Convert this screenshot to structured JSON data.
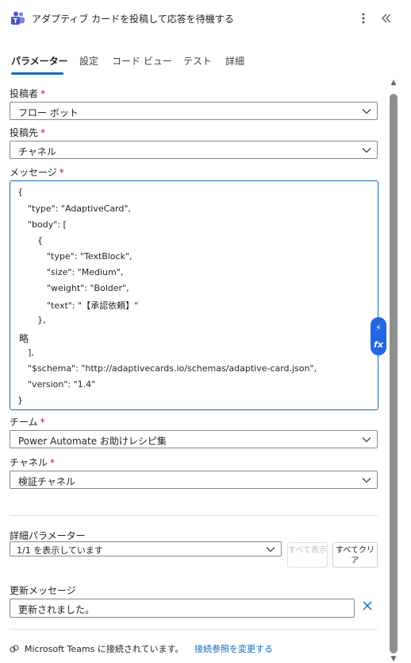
{
  "header": {
    "title": "アダプティブ カードを投稿して応答を待機する",
    "more_icon": "more-vertical-icon",
    "collapse_icon": "double-chevron-left-icon"
  },
  "tabs": [
    {
      "label": "パラメーター",
      "active": true
    },
    {
      "label": "設定",
      "active": false
    },
    {
      "label": "コード ビュー",
      "active": false
    },
    {
      "label": "テスト",
      "active": false
    },
    {
      "label": "詳細",
      "active": false
    }
  ],
  "fields": {
    "poster": {
      "label": "投稿者",
      "value": "フロー ボット"
    },
    "post_in": {
      "label": "投稿先",
      "value": "チャネル"
    },
    "message": {
      "label": "メッセージ",
      "lines": [
        "{",
        "\"type\": \"AdaptiveCard\",",
        "\"body\": [",
        "{",
        "\"type\": \"TextBlock\",",
        "\"size\": \"Medium\",",
        "\"weight\": \"Bolder\",",
        "\"text\": \"【承認依頼】\"",
        "},",
        "略",
        "],",
        "\"$schema\": \"http://adaptivecards.io/schemas/adaptive-card.json\",",
        "\"version\": \"1.4\"",
        "}"
      ]
    },
    "team": {
      "label": "チーム",
      "value": "Power Automate お助けレシピ集"
    },
    "channel": {
      "label": "チャネル",
      "value": "検証チャネル"
    },
    "required_mark": "*"
  },
  "advanced": {
    "label": "詳細パラメーター",
    "select_value": "1/1 を表示しています",
    "show_all": "すべて表示",
    "clear_all": "すべてクリア"
  },
  "update_message": {
    "label": "更新メッセージ",
    "value": "更新されました。"
  },
  "connection": {
    "text": "Microsoft Teams に接続されています。",
    "link": "接続参照を変更する"
  },
  "side_actions": {
    "dynamic": "⚡",
    "expression": "fx"
  },
  "colors": {
    "accent": "#0f6cbd",
    "required": "#c50f1f",
    "side_pill": "#2266e3"
  }
}
